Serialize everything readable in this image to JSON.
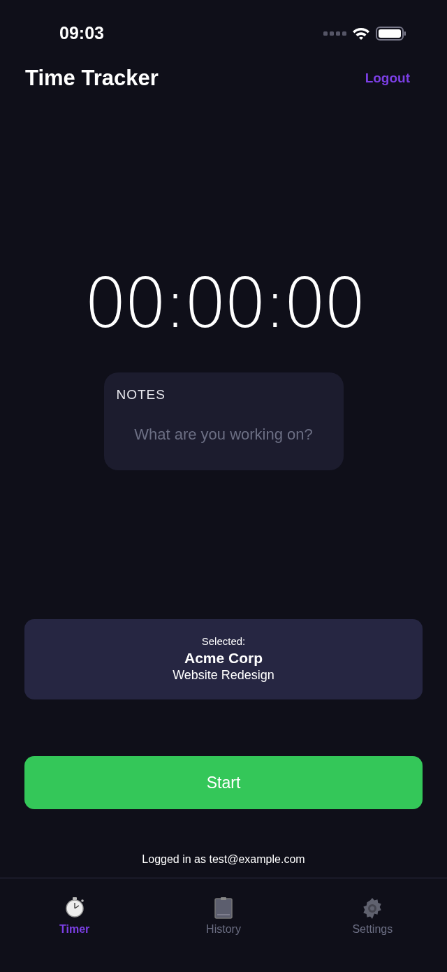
{
  "status_bar": {
    "time": "09:03"
  },
  "header": {
    "title": "Time Tracker",
    "logout": "Logout"
  },
  "timer": {
    "display": "00:00:00"
  },
  "notes": {
    "label": "NOTES",
    "placeholder": "What are you working on?"
  },
  "selection": {
    "caption": "Selected:",
    "client": "Acme Corp",
    "project": "Website Redesign"
  },
  "start_button": {
    "label": "Start"
  },
  "footer_text": "Logged in as test@example.com",
  "tabs": [
    {
      "kind": "timer",
      "label": "Timer",
      "selected": true
    },
    {
      "kind": "history",
      "label": "History",
      "selected": false
    },
    {
      "kind": "settings",
      "label": "Settings",
      "selected": false
    }
  ]
}
